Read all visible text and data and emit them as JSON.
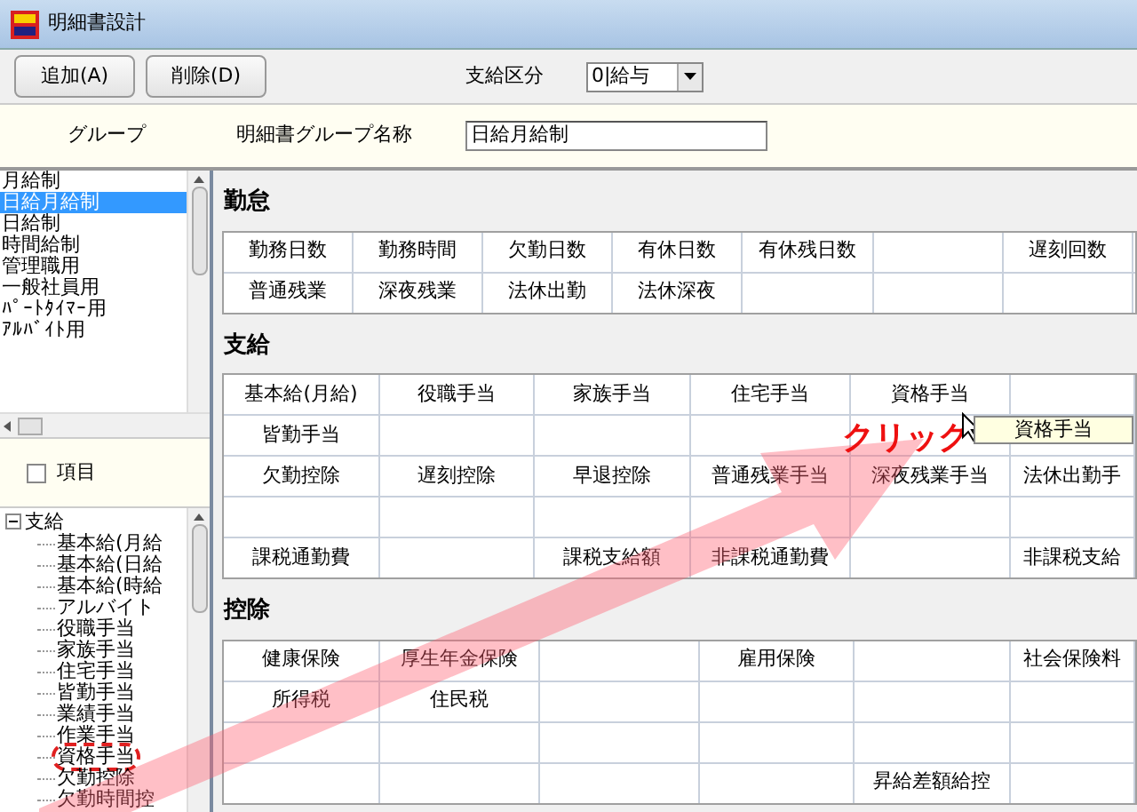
{
  "window": {
    "title": "明細書設計"
  },
  "toolbar": {
    "buttons": [
      "追加(A)",
      "削除(D)"
    ],
    "pay_type": {
      "label": "支給区分",
      "value": "0|給与"
    }
  },
  "group_header": "グループ",
  "group_name": {
    "label": "明細書グループ名称",
    "value": "日給月給制"
  },
  "groups": [
    {
      "label": "月給制",
      "selected": false
    },
    {
      "label": "日給月給制",
      "selected": true
    },
    {
      "label": "日給制",
      "selected": false
    },
    {
      "label": "時間給制",
      "selected": false
    },
    {
      "label": "管理職用",
      "selected": false
    },
    {
      "label": "一般社員用",
      "selected": false
    },
    {
      "label": "ﾊﾟｰﾄﾀｲﾏｰ用",
      "selected": false
    },
    {
      "label": "ｱﾙﾊﾞｲﾄ用",
      "selected": false
    }
  ],
  "item_checkbox": {
    "label": "項目",
    "checked": false
  },
  "tree": [
    {
      "label": "支給",
      "expanded": true,
      "children": [
        {
          "label": "基本給(月給",
          "circled": false
        },
        {
          "label": "基本給(日給",
          "circled": false
        },
        {
          "label": "基本給(時給",
          "circled": false
        },
        {
          "label": "アルバイト",
          "circled": false
        },
        {
          "label": "役職手当",
          "circled": false
        },
        {
          "label": "家族手当",
          "circled": false
        },
        {
          "label": "住宅手当",
          "circled": false
        },
        {
          "label": "皆勤手当",
          "circled": false
        },
        {
          "label": "業績手当",
          "circled": false
        },
        {
          "label": "作業手当",
          "circled": false
        },
        {
          "label": "資格手当",
          "circled": true
        },
        {
          "label": "欠勤控除",
          "circled": false
        },
        {
          "label": "欠勤時間控",
          "circled": false
        }
      ]
    }
  ],
  "sections": [
    {
      "title": "勤怠",
      "kind": "attendance",
      "rows": [
        [
          "勤務日数",
          "勤務時間",
          "欠勤日数",
          "有休日数",
          "有休残日数",
          "",
          "遅刻回数"
        ],
        [
          "普通残業",
          "深夜残業",
          "法休出勤",
          "法休深夜",
          "",
          "",
          ""
        ]
      ]
    },
    {
      "title": "支給",
      "kind": "payment",
      "rows": [
        [
          "基本給(月給)",
          "役職手当",
          "家族手当",
          "住宅手当",
          "資格手当",
          ""
        ],
        [
          "皆勤手当",
          "",
          "",
          "",
          "",
          ""
        ],
        [
          "欠勤控除",
          "遅刻控除",
          "早退控除",
          "普通残業手当",
          "深夜残業手当",
          "法休出勤手"
        ],
        [
          "",
          "",
          "",
          "",
          "",
          ""
        ],
        [
          "課税通勤費",
          "",
          "課税支給額",
          "非課税通勤費",
          "",
          "非課税支給"
        ]
      ]
    },
    {
      "title": "控除",
      "kind": "deduction",
      "rows": [
        [
          "健康保険",
          "厚生年金保険",
          "",
          "雇用保険",
          "",
          "社会保険料"
        ],
        [
          "所得税",
          "住民税",
          "",
          "",
          "",
          ""
        ],
        [
          "",
          "",
          "",
          "",
          "",
          ""
        ],
        [
          "",
          "",
          "",
          "",
          "昇給差額給控",
          ""
        ]
      ]
    }
  ],
  "annotation": {
    "label": "クリック",
    "tooltip": "資格手当"
  }
}
